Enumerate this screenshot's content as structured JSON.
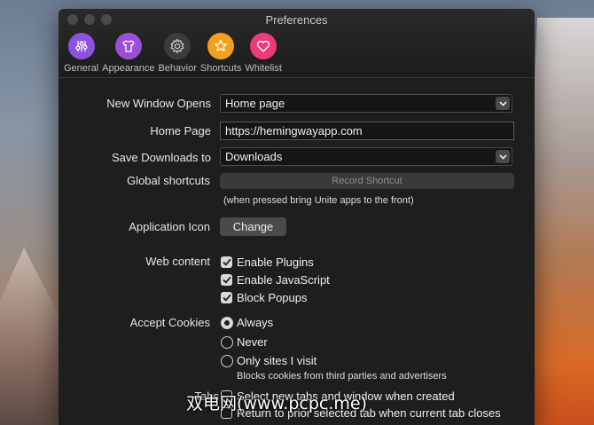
{
  "window": {
    "title": "Preferences"
  },
  "toolbar": {
    "tabs": [
      {
        "label": "General",
        "icon": "sliders-icon",
        "color": "#8e52e0"
      },
      {
        "label": "Appearance",
        "icon": "tshirt-icon",
        "color": "#9a4fd9"
      },
      {
        "label": "Behavior",
        "icon": "gear-icon",
        "color": "#3c3c3c"
      },
      {
        "label": "Shortcuts",
        "icon": "star-icon",
        "color": "#f2a01f"
      },
      {
        "label": "Whitelist",
        "icon": "heart-icon",
        "color": "#ee3a78"
      }
    ]
  },
  "general": {
    "new_window_label": "New Window Opens",
    "new_window_value": "Home page",
    "home_page_label": "Home Page",
    "home_page_value": "https://hemingwayapp.com",
    "save_downloads_label": "Save Downloads to",
    "save_downloads_value": "Downloads",
    "global_shortcuts_label": "Global shortcuts",
    "record_shortcut_label": "Record Shortcut",
    "shortcut_hint": "(when pressed bring Unite apps to the front)",
    "app_icon_label": "Application Icon",
    "change_button": "Change",
    "web_content_label": "Web content",
    "web_content_options": [
      {
        "label": "Enable Plugins",
        "checked": true
      },
      {
        "label": "Enable JavaScript",
        "checked": true
      },
      {
        "label": "Block Popups",
        "checked": true
      }
    ],
    "cookies_label": "Accept Cookies",
    "cookies_options": [
      {
        "label": "Always",
        "selected": true
      },
      {
        "label": "Never",
        "selected": false
      },
      {
        "label": "Only sites I visit",
        "selected": false
      }
    ],
    "cookies_hint": "Blocks cookies from third parties and advertisers",
    "tabs_label": "Tabs",
    "tabs_options": [
      {
        "label": "Select new tabs and window when created",
        "checked": false
      },
      {
        "label": "Return to prior selected tab when current tab closes",
        "checked": false
      }
    ]
  },
  "watermark": "双电网(www.pcpc.me)"
}
